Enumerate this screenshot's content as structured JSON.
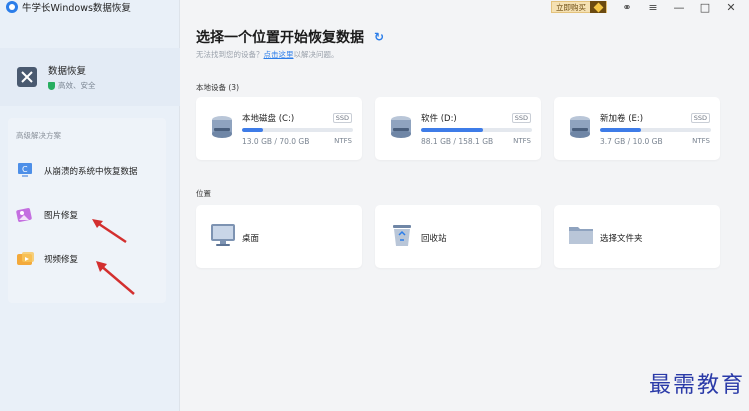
{
  "app": {
    "title": "牛学长Windows数据恢复"
  },
  "topbar": {
    "buy_label": "立即购买"
  },
  "sidebar": {
    "primary": {
      "title": "数据恢复",
      "subtitle": "高效、安全"
    },
    "advanced_label": "高级解决方案",
    "items": [
      {
        "label": "从崩溃的系统中恢复数据",
        "icon": "monitor-icon"
      },
      {
        "label": "图片修复",
        "icon": "photo-icon"
      },
      {
        "label": "视频修复",
        "icon": "video-icon"
      }
    ]
  },
  "main": {
    "title": "选择一个位置开始恢复数据",
    "hint_prefix": "无法找到您的设备？",
    "hint_link": "点击这里",
    "hint_suffix": "以解决问题。",
    "devices_label": "本地设备 (3)",
    "drives": [
      {
        "name": "本地磁盘 (C:)",
        "badge": "SSD",
        "size": "13.0 GB / 70.0 GB",
        "fs": "NTFS",
        "used_fraction": 0.186
      },
      {
        "name": "软件 (D:)",
        "badge": "SSD",
        "size": "88.1 GB / 158.1 GB",
        "fs": "NTFS",
        "used_fraction": 0.557
      },
      {
        "name": "新加卷 (E:)",
        "badge": "SSD",
        "size": "3.7 GB / 10.0 GB",
        "fs": "NTFS",
        "used_fraction": 0.37
      }
    ],
    "locations_label": "位置",
    "locations": [
      {
        "label": "桌面",
        "icon": "desktop-icon"
      },
      {
        "label": "回收站",
        "icon": "recycle-bin-icon"
      },
      {
        "label": "选择文件夹",
        "icon": "folder-icon"
      }
    ]
  },
  "watermark": "最需教育",
  "colors": {
    "accent": "#3e7ce8",
    "sidebar_bg": "#e9f0f8",
    "arrow": "#d32f2f"
  }
}
